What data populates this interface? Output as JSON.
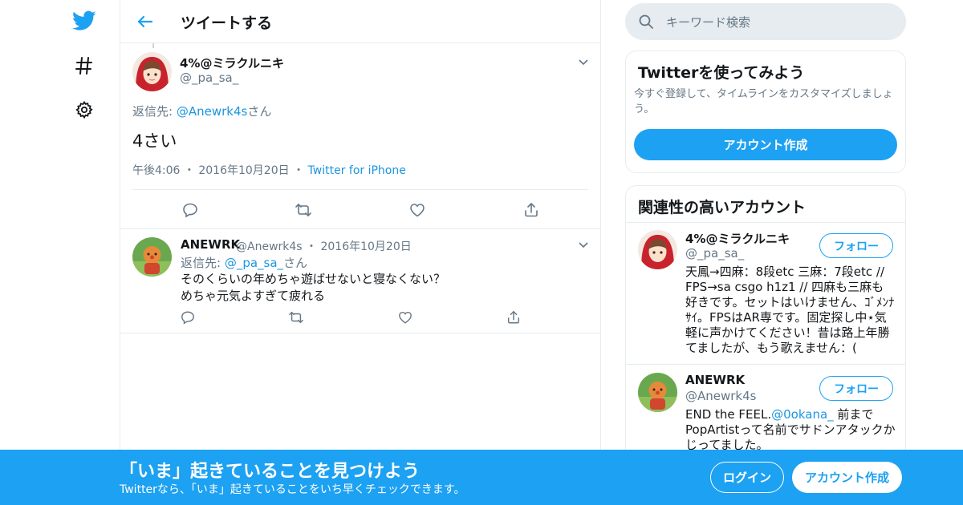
{
  "colors": {
    "accent": "#1da1f2",
    "text": "#14171a",
    "muted": "#657786",
    "border": "#e6ecf0"
  },
  "nav": {
    "icons": [
      "twitter-bird-icon",
      "hashtag-icon",
      "gear-icon"
    ]
  },
  "header": {
    "title": "ツイートする",
    "back_icon": "back-arrow-icon"
  },
  "focus_tweet": {
    "name": "4%@ミラクルニキ",
    "handle": "@_pa_sa_",
    "reply_prefix": "返信先: ",
    "reply_link": "@Anewrk4s",
    "reply_suffix": "さん",
    "text": "4さい",
    "time": "午後4:06",
    "dot": "・",
    "date": "2016年10月20日",
    "source": "Twitter for iPhone",
    "actions": [
      "reply-icon",
      "retweet-icon",
      "like-icon",
      "share-icon"
    ]
  },
  "reply_tweet": {
    "name": "ANEWRK",
    "handle": "@Anewrk4s",
    "dot": "・",
    "date": "2016年10月20日",
    "reply_prefix": "返信先: ",
    "reply_link": "@_pa_sa_",
    "reply_suffix": "さん",
    "line1": "そのくらいの年めちゃ遊ばせないと寝なくない？",
    "line2": "めちゃ元気よすぎて疲れる"
  },
  "search": {
    "placeholder": "キーワード検索"
  },
  "try_card": {
    "title": "Twitterを使ってみよう",
    "desc": "今すぐ登録して、タイムラインをカスタマイズしましょう。",
    "button": "アカウント作成"
  },
  "related": {
    "title": "関連性の高いアカウント",
    "accounts": [
      {
        "name": "4%@ミラクルニキ",
        "handle": "@_pa_sa_",
        "follow": "フォロー",
        "bio": "天鳳→四麻：8段etc 三麻：7段etc // FPS→sa csgo h1z1 // 四麻も三麻も好きです。セットはいけません、ｺﾞﾒﾝﾅｻｲ。FPSはAR専です。固定探し中⋆気軽に声かけてください！昔は路上年勝てましたが、もう歌えません：("
      },
      {
        "name": "ANEWRK",
        "handle": "@Anewrk4s",
        "follow": "フォロー",
        "bio_prefix": "END the FEEL.",
        "bio_link": "@0okana_",
        "bio_suffix": " 前までPopArtistって名前でサドンアタックかじってました。"
      }
    ]
  },
  "banner": {
    "title": "「いま」起きていることを見つけよう",
    "subtitle": "Twitterなら、「いま」起きていることをいち早くチェックできます。",
    "login": "ログイン",
    "signup": "アカウント作成"
  }
}
